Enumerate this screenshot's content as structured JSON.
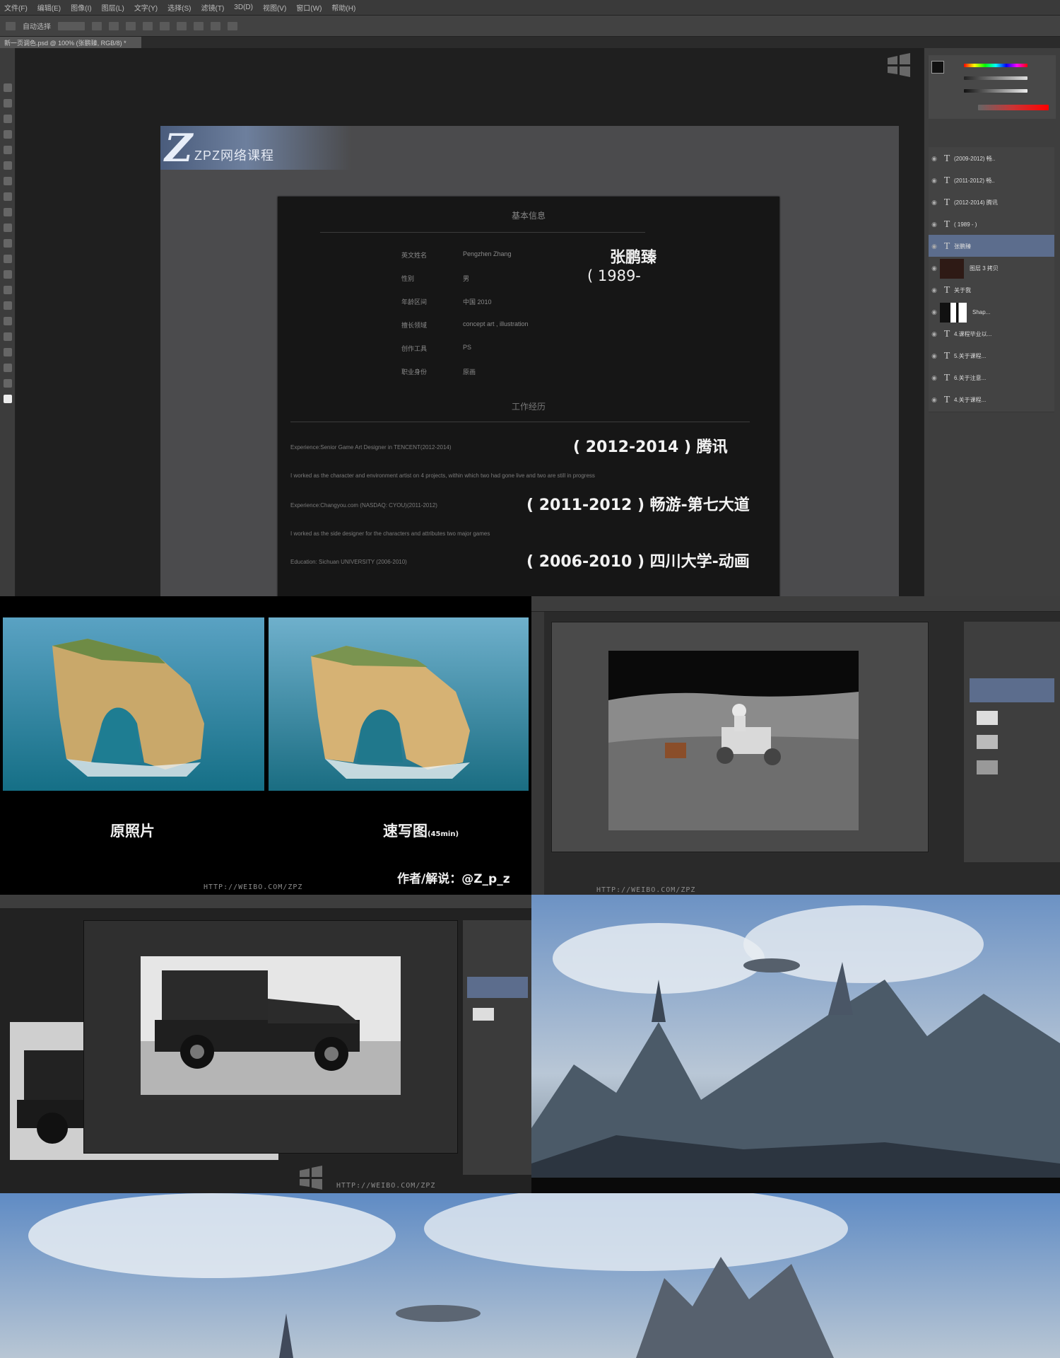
{
  "ps_main": {
    "menu": [
      "文件(F)",
      "编辑(E)",
      "图像(I)",
      "图层(L)",
      "文字(Y)",
      "选择(S)",
      "滤镜(T)",
      "3D(D)",
      "视图(V)",
      "窗口(W)",
      "帮助(H)"
    ],
    "options_label": "自动选择",
    "doc_tab": "新一页调色.psd @ 100% (张鹏臻, RGB/8) *"
  },
  "logo": {
    "mark": "Z",
    "text": "ZPZ网络课程"
  },
  "resume": {
    "section_basic": "基本信息",
    "rows": [
      {
        "label": "英文姓名",
        "value": "Pengzhen Zhang"
      },
      {
        "label": "性别",
        "value": "男"
      },
      {
        "label": "年龄区间",
        "value": "中国 2010"
      },
      {
        "label": "擅长领域",
        "value": "concept art , illustration"
      },
      {
        "label": "创作工具",
        "value": "PS"
      },
      {
        "label": "职业身份",
        "value": "原画"
      }
    ],
    "name_cn": "张鹏臻",
    "birth": "( 1989-",
    "section_work": "工作经历",
    "experiences": [
      {
        "small": "Experience:Senior Game Art Designer in TENCENT(2012-2014)",
        "big": "( 2012-2014 ) 腾讯"
      },
      {
        "small": "I worked as the character and environment artist on 4 projects, within which two had gone live and two are still in progress",
        "big": ""
      },
      {
        "small": "Experience:Changyou.com (NASDAQ: CYOU)(2011-2012)",
        "big": "( 2011-2012 ) 畅游-第七大道"
      },
      {
        "small": "I worked as the side designer for the characters and attributes two major games",
        "big": ""
      },
      {
        "small": "Education: Sichuan UNIVERSITY (2006-2010)",
        "big": "( 2006-2010 ) 四川大学-动画"
      }
    ]
  },
  "layers": [
    {
      "name": "(2009-2012) 畅..",
      "kind": "T"
    },
    {
      "name": "(2011-2012) 畅..",
      "kind": "T"
    },
    {
      "name": "(2012-2014) 腾讯",
      "kind": "T"
    },
    {
      "name": "( 1989 - )",
      "kind": "T"
    },
    {
      "name": "张鹏臻",
      "kind": "T",
      "selected": true
    },
    {
      "name": "图层 3 拷贝",
      "kind": "thumb"
    },
    {
      "name": "关于我",
      "kind": "T"
    },
    {
      "name": "Shap...",
      "kind": "wb"
    },
    {
      "name": "4.课程毕业以...",
      "kind": "T"
    },
    {
      "name": "5.关于课程...",
      "kind": "T"
    },
    {
      "name": "6.关于注意...",
      "kind": "T"
    },
    {
      "name": "4.关于课程...",
      "kind": "T"
    }
  ],
  "compare": {
    "caption_left": "原照片",
    "caption_right": "速写图",
    "caption_right_sub": "(45min)",
    "author": "作者/解说：@Z_p_z",
    "url": "HTTP://WEIBO.COM/ZPZ"
  },
  "moon": {
    "url": "HTTP://WEIBO.COM/ZPZ"
  },
  "car": {
    "url": "HTTP://WEIBO.COM/ZPZ"
  },
  "colors": {
    "ps_dark": "#2b2b2b",
    "card": "#161616",
    "selected_layer": "#5c6d8d",
    "sea": "#1f7f96"
  }
}
